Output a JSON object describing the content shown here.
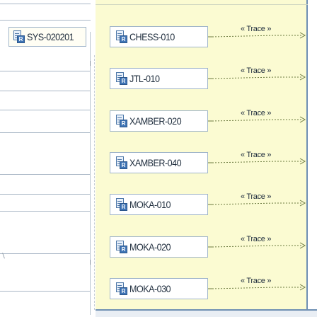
{
  "root": {
    "label": "SYS-020201",
    "icon": "requirement-icon"
  },
  "rows": [
    {
      "label": "CHESS-010",
      "trace": "« Trace »"
    },
    {
      "label": "JTL-010",
      "trace": "« Trace »"
    },
    {
      "label": "XAMBER-020",
      "trace": "« Trace »"
    },
    {
      "label": "XAMBER-040",
      "trace": "« Trace »"
    },
    {
      "label": "MOKA-010",
      "trace": "« Trace »"
    },
    {
      "label": "MOKA-020",
      "trace": "« Trace »"
    },
    {
      "label": "MOKA-030",
      "trace": "« Trace »"
    }
  ],
  "colors": {
    "canvas": "#fbfbd2",
    "box_border": "#9fb4c9",
    "trace_line": "#6b7a3f",
    "frame": "#6e8fb3"
  }
}
